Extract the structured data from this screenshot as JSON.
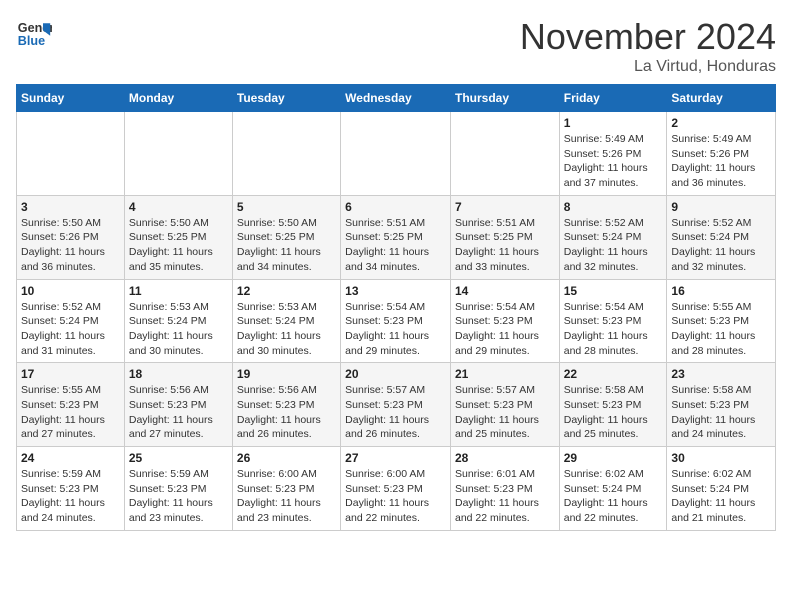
{
  "logo": {
    "line1": "General",
    "line2": "Blue"
  },
  "title": "November 2024",
  "location": "La Virtud, Honduras",
  "weekdays": [
    "Sunday",
    "Monday",
    "Tuesday",
    "Wednesday",
    "Thursday",
    "Friday",
    "Saturday"
  ],
  "weeks": [
    [
      {
        "day": "",
        "info": ""
      },
      {
        "day": "",
        "info": ""
      },
      {
        "day": "",
        "info": ""
      },
      {
        "day": "",
        "info": ""
      },
      {
        "day": "",
        "info": ""
      },
      {
        "day": "1",
        "info": "Sunrise: 5:49 AM\nSunset: 5:26 PM\nDaylight: 11 hours and 37 minutes."
      },
      {
        "day": "2",
        "info": "Sunrise: 5:49 AM\nSunset: 5:26 PM\nDaylight: 11 hours and 36 minutes."
      }
    ],
    [
      {
        "day": "3",
        "info": "Sunrise: 5:50 AM\nSunset: 5:26 PM\nDaylight: 11 hours and 36 minutes."
      },
      {
        "day": "4",
        "info": "Sunrise: 5:50 AM\nSunset: 5:25 PM\nDaylight: 11 hours and 35 minutes."
      },
      {
        "day": "5",
        "info": "Sunrise: 5:50 AM\nSunset: 5:25 PM\nDaylight: 11 hours and 34 minutes."
      },
      {
        "day": "6",
        "info": "Sunrise: 5:51 AM\nSunset: 5:25 PM\nDaylight: 11 hours and 34 minutes."
      },
      {
        "day": "7",
        "info": "Sunrise: 5:51 AM\nSunset: 5:25 PM\nDaylight: 11 hours and 33 minutes."
      },
      {
        "day": "8",
        "info": "Sunrise: 5:52 AM\nSunset: 5:24 PM\nDaylight: 11 hours and 32 minutes."
      },
      {
        "day": "9",
        "info": "Sunrise: 5:52 AM\nSunset: 5:24 PM\nDaylight: 11 hours and 32 minutes."
      }
    ],
    [
      {
        "day": "10",
        "info": "Sunrise: 5:52 AM\nSunset: 5:24 PM\nDaylight: 11 hours and 31 minutes."
      },
      {
        "day": "11",
        "info": "Sunrise: 5:53 AM\nSunset: 5:24 PM\nDaylight: 11 hours and 30 minutes."
      },
      {
        "day": "12",
        "info": "Sunrise: 5:53 AM\nSunset: 5:24 PM\nDaylight: 11 hours and 30 minutes."
      },
      {
        "day": "13",
        "info": "Sunrise: 5:54 AM\nSunset: 5:23 PM\nDaylight: 11 hours and 29 minutes."
      },
      {
        "day": "14",
        "info": "Sunrise: 5:54 AM\nSunset: 5:23 PM\nDaylight: 11 hours and 29 minutes."
      },
      {
        "day": "15",
        "info": "Sunrise: 5:54 AM\nSunset: 5:23 PM\nDaylight: 11 hours and 28 minutes."
      },
      {
        "day": "16",
        "info": "Sunrise: 5:55 AM\nSunset: 5:23 PM\nDaylight: 11 hours and 28 minutes."
      }
    ],
    [
      {
        "day": "17",
        "info": "Sunrise: 5:55 AM\nSunset: 5:23 PM\nDaylight: 11 hours and 27 minutes."
      },
      {
        "day": "18",
        "info": "Sunrise: 5:56 AM\nSunset: 5:23 PM\nDaylight: 11 hours and 27 minutes."
      },
      {
        "day": "19",
        "info": "Sunrise: 5:56 AM\nSunset: 5:23 PM\nDaylight: 11 hours and 26 minutes."
      },
      {
        "day": "20",
        "info": "Sunrise: 5:57 AM\nSunset: 5:23 PM\nDaylight: 11 hours and 26 minutes."
      },
      {
        "day": "21",
        "info": "Sunrise: 5:57 AM\nSunset: 5:23 PM\nDaylight: 11 hours and 25 minutes."
      },
      {
        "day": "22",
        "info": "Sunrise: 5:58 AM\nSunset: 5:23 PM\nDaylight: 11 hours and 25 minutes."
      },
      {
        "day": "23",
        "info": "Sunrise: 5:58 AM\nSunset: 5:23 PM\nDaylight: 11 hours and 24 minutes."
      }
    ],
    [
      {
        "day": "24",
        "info": "Sunrise: 5:59 AM\nSunset: 5:23 PM\nDaylight: 11 hours and 24 minutes."
      },
      {
        "day": "25",
        "info": "Sunrise: 5:59 AM\nSunset: 5:23 PM\nDaylight: 11 hours and 23 minutes."
      },
      {
        "day": "26",
        "info": "Sunrise: 6:00 AM\nSunset: 5:23 PM\nDaylight: 11 hours and 23 minutes."
      },
      {
        "day": "27",
        "info": "Sunrise: 6:00 AM\nSunset: 5:23 PM\nDaylight: 11 hours and 22 minutes."
      },
      {
        "day": "28",
        "info": "Sunrise: 6:01 AM\nSunset: 5:23 PM\nDaylight: 11 hours and 22 minutes."
      },
      {
        "day": "29",
        "info": "Sunrise: 6:02 AM\nSunset: 5:24 PM\nDaylight: 11 hours and 22 minutes."
      },
      {
        "day": "30",
        "info": "Sunrise: 6:02 AM\nSunset: 5:24 PM\nDaylight: 11 hours and 21 minutes."
      }
    ]
  ]
}
